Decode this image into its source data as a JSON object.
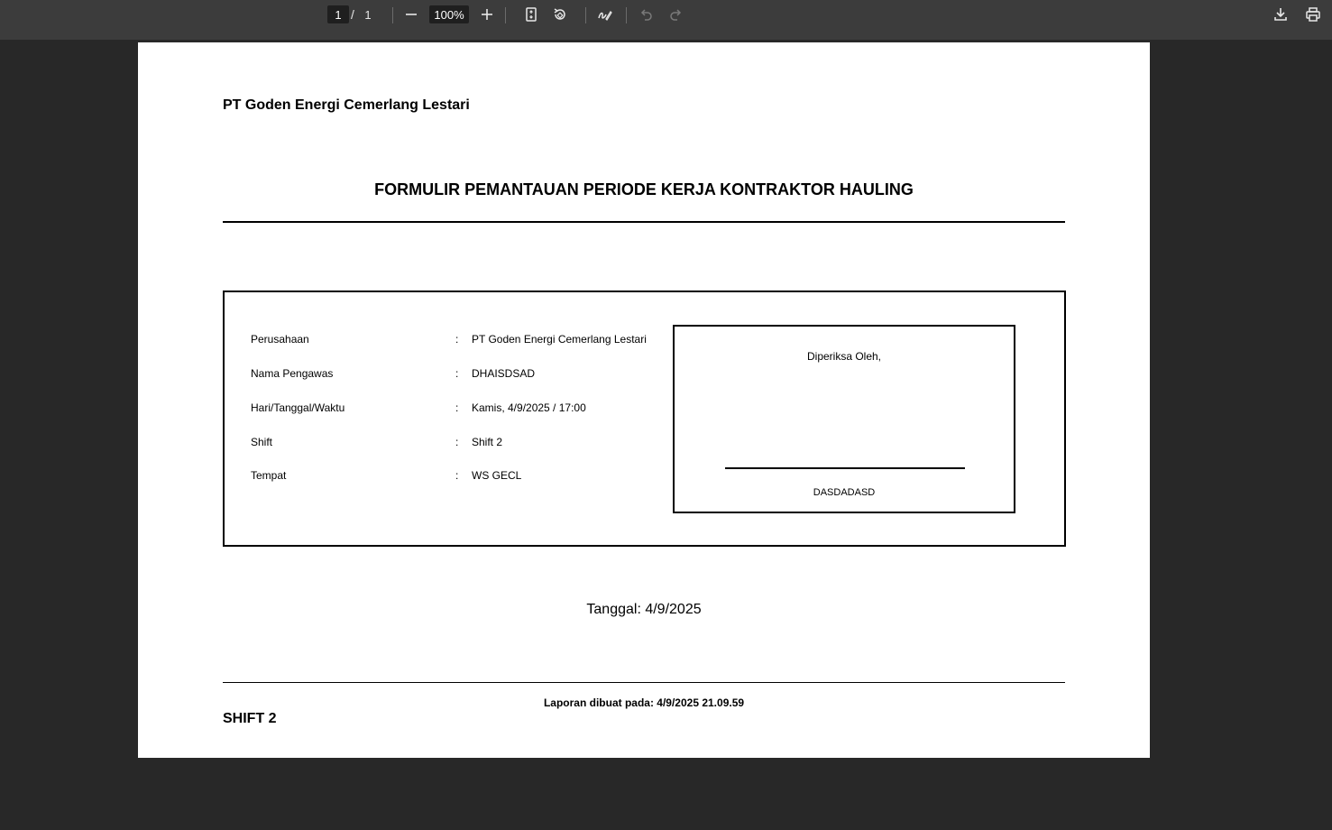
{
  "toolbar": {
    "page_current": "1",
    "page_separator": "/",
    "page_total": "1",
    "zoom": "100%",
    "icons": [
      "zoom-out-icon",
      "zoom-in-icon",
      "fit-page-icon",
      "rotate-icon",
      "annotate-icon",
      "undo-icon",
      "redo-icon",
      "download-icon",
      "print-icon"
    ]
  },
  "document": {
    "company_header": "PT Goden Energi Cemerlang Lestari",
    "form_title": "FORMULIR PEMANTAUAN PERIODE KERJA KONTRAKTOR HAULING",
    "fields": [
      {
        "label": "Perusahaan",
        "colon": ":",
        "value": "PT Goden Energi Cemerlang Lestari"
      },
      {
        "label": "Nama Pengawas",
        "colon": ":",
        "value": "DHAISDSAD"
      },
      {
        "label": "Hari/Tanggal/Waktu",
        "colon": ":",
        "value": "Kamis, 4/9/2025 / 17:00"
      },
      {
        "label": "Shift",
        "colon": ":",
        "value": "Shift 2"
      },
      {
        "label": "Tempat",
        "colon": ":",
        "value": "WS GECL"
      }
    ],
    "signature": {
      "heading": "Diperiksa Oleh,",
      "name": "DASDADASD"
    },
    "date_line": "Tanggal: 4/9/2025",
    "generated_at": "Laporan dibuat pada: 4/9/2025 21.09.59",
    "shift_footer": "SHIFT 2"
  }
}
